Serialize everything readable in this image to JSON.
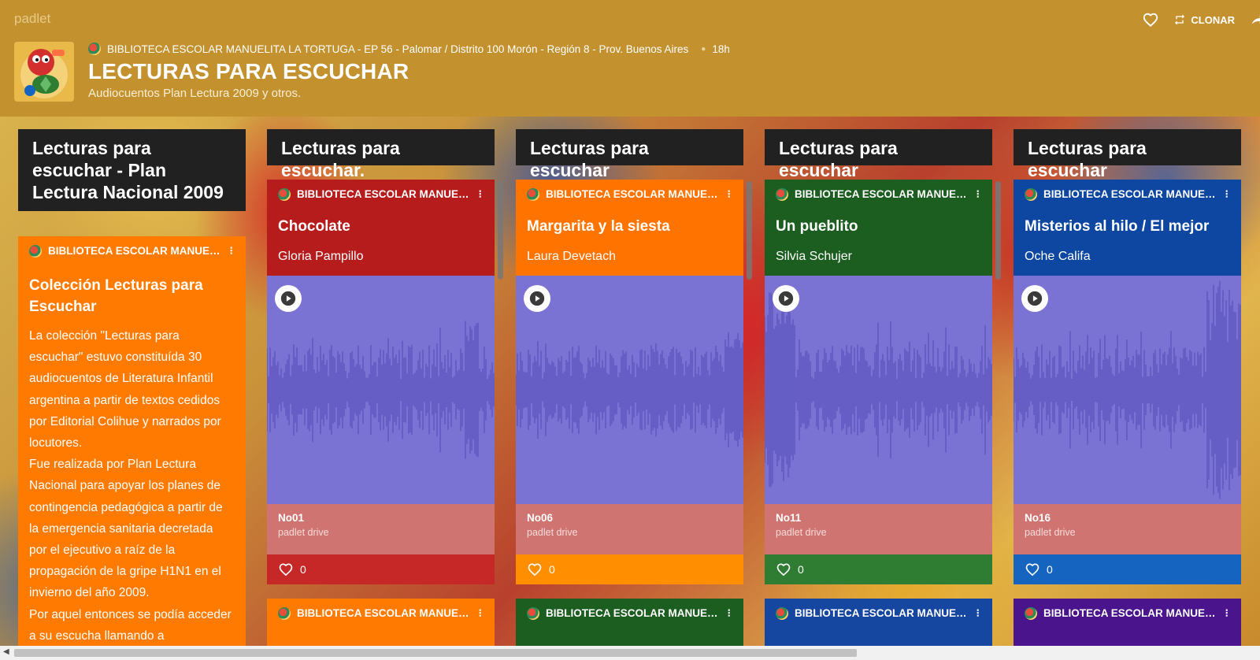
{
  "header": {
    "brand": "padlet",
    "clone_label": "CLONAR",
    "breadcrumb": "BIBLIOTECA ESCOLAR MANUELITA LA TORTUGA - EP 56 - Palomar / Distrito 100 Morón - Región 8 - Prov. Buenos Aires",
    "time": "18h",
    "title": "LECTURAS PARA ESCUCHAR",
    "subtitle": "Audiocuentos Plan Lectura 2009 y otros."
  },
  "columns": [
    {
      "title": "Lecturas para escuchar - Plan Lectura Nacional 2009",
      "post": {
        "author": "BIBLIOTECA ESCOLAR MANUELITA LA TORTUGA",
        "title": "Colección Lecturas para Escuchar",
        "body": [
          "La colección \"Lecturas para escuchar\" estuvo constituída 30 audiocuentos de Literatura Infantil argentina a partir de textos cedidos por Editorial Colihue y narrados por locutores.",
          "Fue realizada por Plan Lectura Nacional para apoyar los planes de contingencia pedagógica a partir de  la emergencia sanitaria decretada por el ejecutivo a raíz de la propagación de la gripe H1N1 en el invierno del año 2009.",
          "Por aquel entonces se podía acceder a su escucha llamando a"
        ],
        "color": "#ff7a00"
      }
    },
    {
      "title": "Lecturas para escuchar.",
      "post": {
        "author": "BIBLIOTECA ESCOLAR MANUELITA LA TORTUGA",
        "title": "Chocolate",
        "subtitle": "Gloria Pampillo",
        "file": "No01",
        "source": "padlet drive",
        "likes": "0",
        "color": "#b71c1c",
        "foot_color": "#c62828"
      },
      "next_post": {
        "author": "BIBLIOTECA ESCOLAR MANUELITA LA TORTUGA",
        "color": "#ff7a00"
      }
    },
    {
      "title": "Lecturas para escuchar",
      "post": {
        "author": "BIBLIOTECA ESCOLAR MANUELITA LA TORTUGA",
        "title": "Margarita y la siesta",
        "subtitle": "Laura Devetach",
        "file": "No06",
        "source": "padlet drive",
        "likes": "0",
        "color": "#ff7400",
        "foot_color": "#ff8f00"
      },
      "next_post": {
        "author": "BIBLIOTECA ESCOLAR MANUELITA LA TORTUGA",
        "color": "#1b5e20"
      }
    },
    {
      "title": "Lecturas para escuchar",
      "post": {
        "author": "BIBLIOTECA ESCOLAR MANUELITA LA TORTUGA",
        "title": "Un pueblito",
        "subtitle": "Silvia Schujer",
        "file": "No11",
        "source": "padlet drive",
        "likes": "0",
        "color": "#1b5e20",
        "foot_color": "#2e7d32"
      },
      "next_post": {
        "author": "BIBLIOTECA ESCOLAR MANUELITA LA TORTUGA",
        "color": "#1546a0"
      }
    },
    {
      "title": "Lecturas para escuchar",
      "post": {
        "author": "BIBLIOTECA ESCOLAR MANUELITA LA TORTUGA",
        "title": "Misterios al hilo / El mejor",
        "subtitle": "Oche Califa",
        "file": "No16",
        "source": "padlet drive",
        "likes": "0",
        "color": "#0d47a1",
        "foot_color": "#1565c0"
      },
      "next_post": {
        "author": "BIBLIOTECA ESCOLAR MANUELITA LA TORTUGA",
        "color": "#4a148c"
      }
    }
  ]
}
